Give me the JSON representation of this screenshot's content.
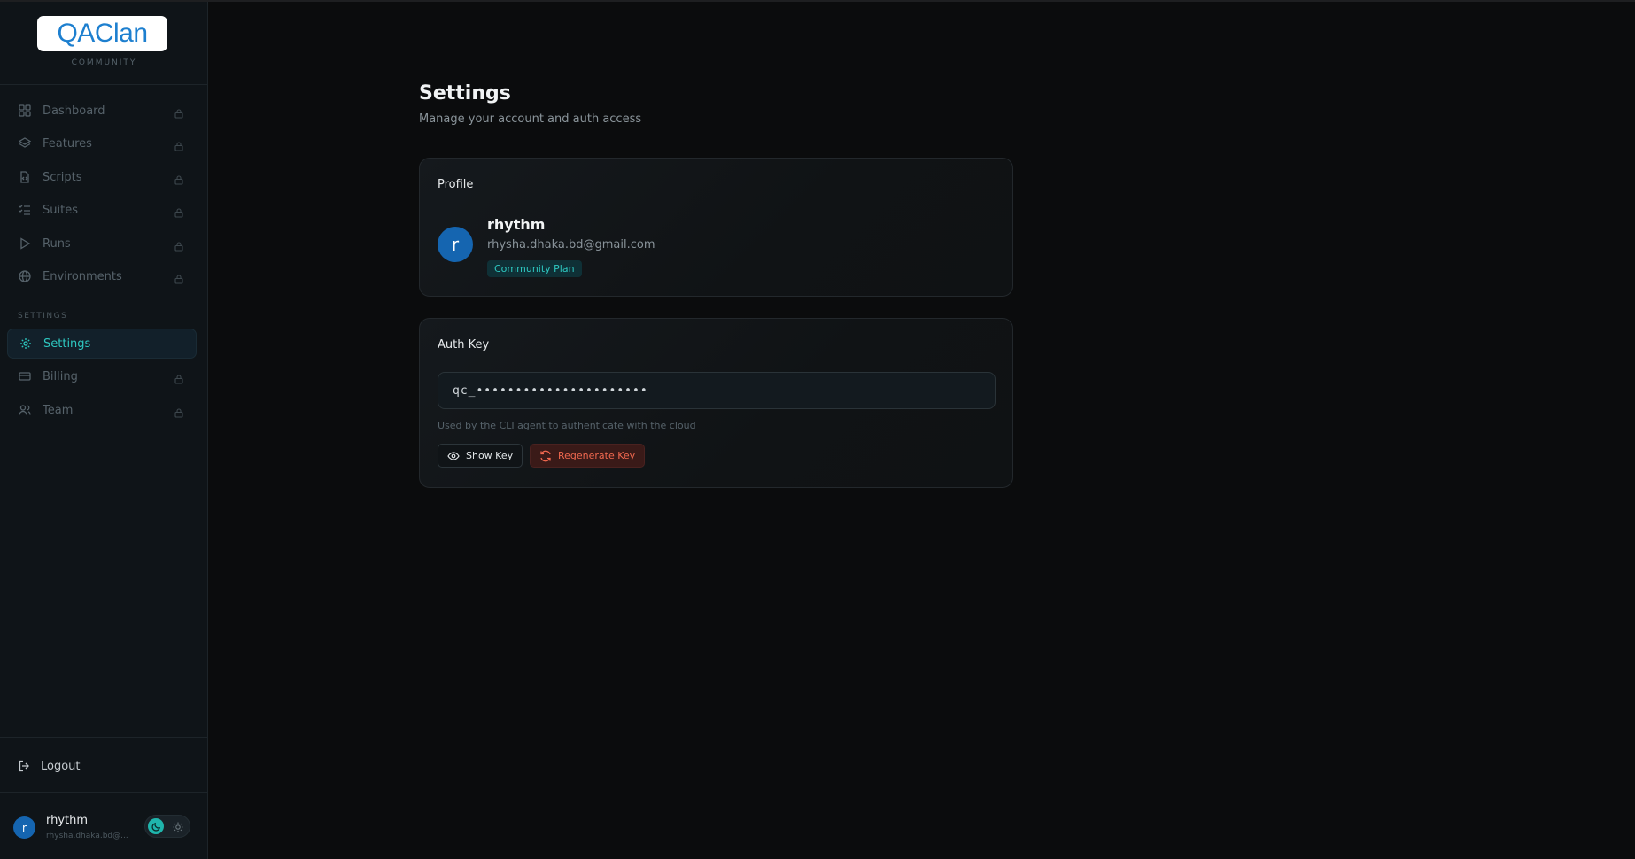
{
  "sidebar": {
    "logo": "QAClan",
    "tier": "COMMUNITY",
    "nav": [
      {
        "label": "Dashboard",
        "icon": "grid-icon",
        "locked": true
      },
      {
        "label": "Features",
        "icon": "layers-icon",
        "locked": true
      },
      {
        "label": "Scripts",
        "icon": "file-code-icon",
        "locked": true
      },
      {
        "label": "Suites",
        "icon": "list-checks-icon",
        "locked": true
      },
      {
        "label": "Runs",
        "icon": "play-icon",
        "locked": true
      },
      {
        "label": "Environments",
        "icon": "globe-icon",
        "locked": true
      }
    ],
    "section_label": "SETTINGS",
    "settings_nav": [
      {
        "label": "Settings",
        "icon": "gear-icon",
        "locked": false,
        "active": true
      },
      {
        "label": "Billing",
        "icon": "credit-card-icon",
        "locked": true
      },
      {
        "label": "Team",
        "icon": "users-icon",
        "locked": true
      }
    ],
    "logout_label": "Logout",
    "user": {
      "initial": "r",
      "name": "rhythm",
      "email": "rhysha.dhaka.bd@..."
    }
  },
  "page": {
    "title": "Settings",
    "subtitle": "Manage your account and auth access"
  },
  "profile": {
    "title": "Profile",
    "initial": "r",
    "name": "rhythm",
    "email": "rhysha.dhaka.bd@gmail.com",
    "plan": "Community Plan"
  },
  "auth": {
    "title": "Auth Key",
    "masked_key": "qc_••••••••••••••••••••••",
    "hint": "Used by the CLI agent to authenticate with the cloud",
    "show_label": "Show Key",
    "regen_label": "Regenerate Key"
  },
  "colors": {
    "accent": "#2ec7c0",
    "avatar": "#1565b0",
    "danger": "#f0684f"
  }
}
